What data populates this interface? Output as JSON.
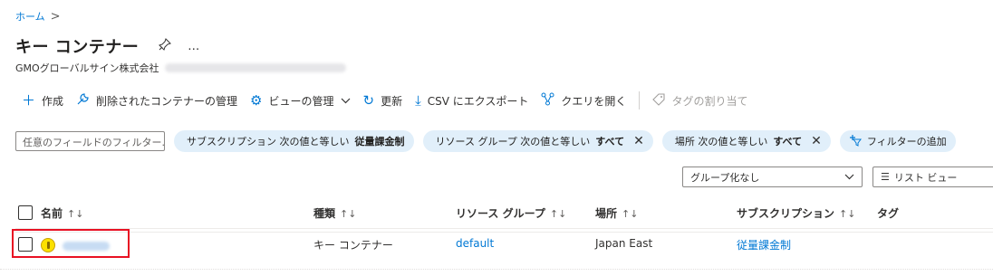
{
  "breadcrumb": {
    "home": "ホーム",
    "separator": ">"
  },
  "header": {
    "title": "キー コンテナー",
    "pin_icon": "pin-icon",
    "more": "…"
  },
  "subtitle": {
    "org": "GMOグローバルサイン株式会社"
  },
  "toolbar": {
    "create": "作成",
    "deleted_vaults": "削除されたコンテナーの管理",
    "manage_view": "ビューの管理",
    "refresh": "更新",
    "export_csv": "CSV にエクスポート",
    "open_query": "クエリを開く",
    "assign_tags": "タグの割り当て"
  },
  "filters": {
    "placeholder": "任意のフィールドのフィルター...",
    "subscription": {
      "label": "サブスクリプション 次の値と等しい",
      "value": "従量課金制"
    },
    "resource_group": {
      "label": "リソース グループ 次の値と等しい",
      "value": "すべて"
    },
    "location": {
      "label": "場所 次の値と等しい",
      "value": "すべて"
    },
    "add_filter": "フィルターの追加"
  },
  "grouping": {
    "value": "グループ化なし"
  },
  "view": {
    "value": "リスト ビュー"
  },
  "table": {
    "columns": {
      "name": "名前",
      "type": "種類",
      "resource_group": "リソース グループ",
      "location": "場所",
      "subscription": "サブスクリプション",
      "tags": "タグ"
    },
    "sort_glyph": "↑↓",
    "rows": [
      {
        "type": "キー コンテナー",
        "resource_group": "default",
        "location": "Japan East",
        "subscription": "従量課金制"
      }
    ]
  },
  "colors": {
    "accent": "#0078d4",
    "pill_bg": "#e1effa",
    "highlight": "#e81123"
  }
}
